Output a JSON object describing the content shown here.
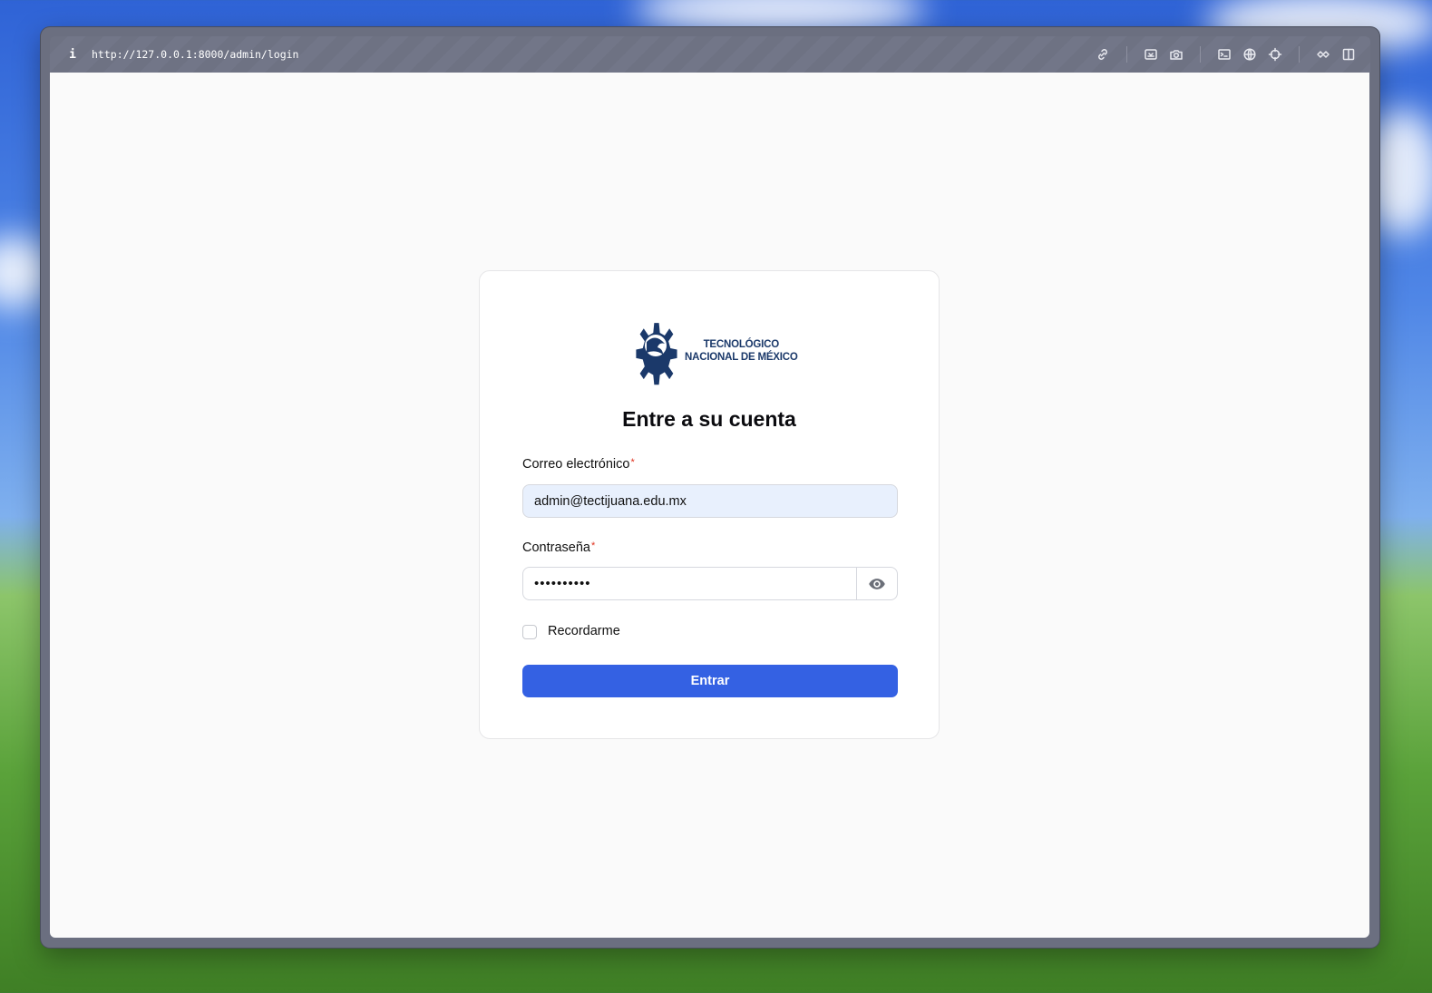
{
  "browser": {
    "url": "http://127.0.0.1:8000/admin/login",
    "info_label": "i",
    "tool_icons": [
      "link-icon",
      "screen-capture-icon",
      "camera-icon",
      "terminal-icon",
      "globe-icon",
      "crosshair-icon",
      "extensions-icon",
      "split-view-icon"
    ]
  },
  "logo": {
    "line1": "TECNOLÓGICO",
    "line2": "NACIONAL DE MÉXICO",
    "color": "#1b396a"
  },
  "login": {
    "title": "Entre a su cuenta",
    "email_label": "Correo electrónico",
    "email_value": "admin@tectijuana.edu.mx",
    "password_label": "Contraseña",
    "password_value": "••••••••••",
    "required_mark": "*",
    "remember_label": "Recordarme",
    "submit_label": "Entrar",
    "accent_color": "#3461e3"
  }
}
